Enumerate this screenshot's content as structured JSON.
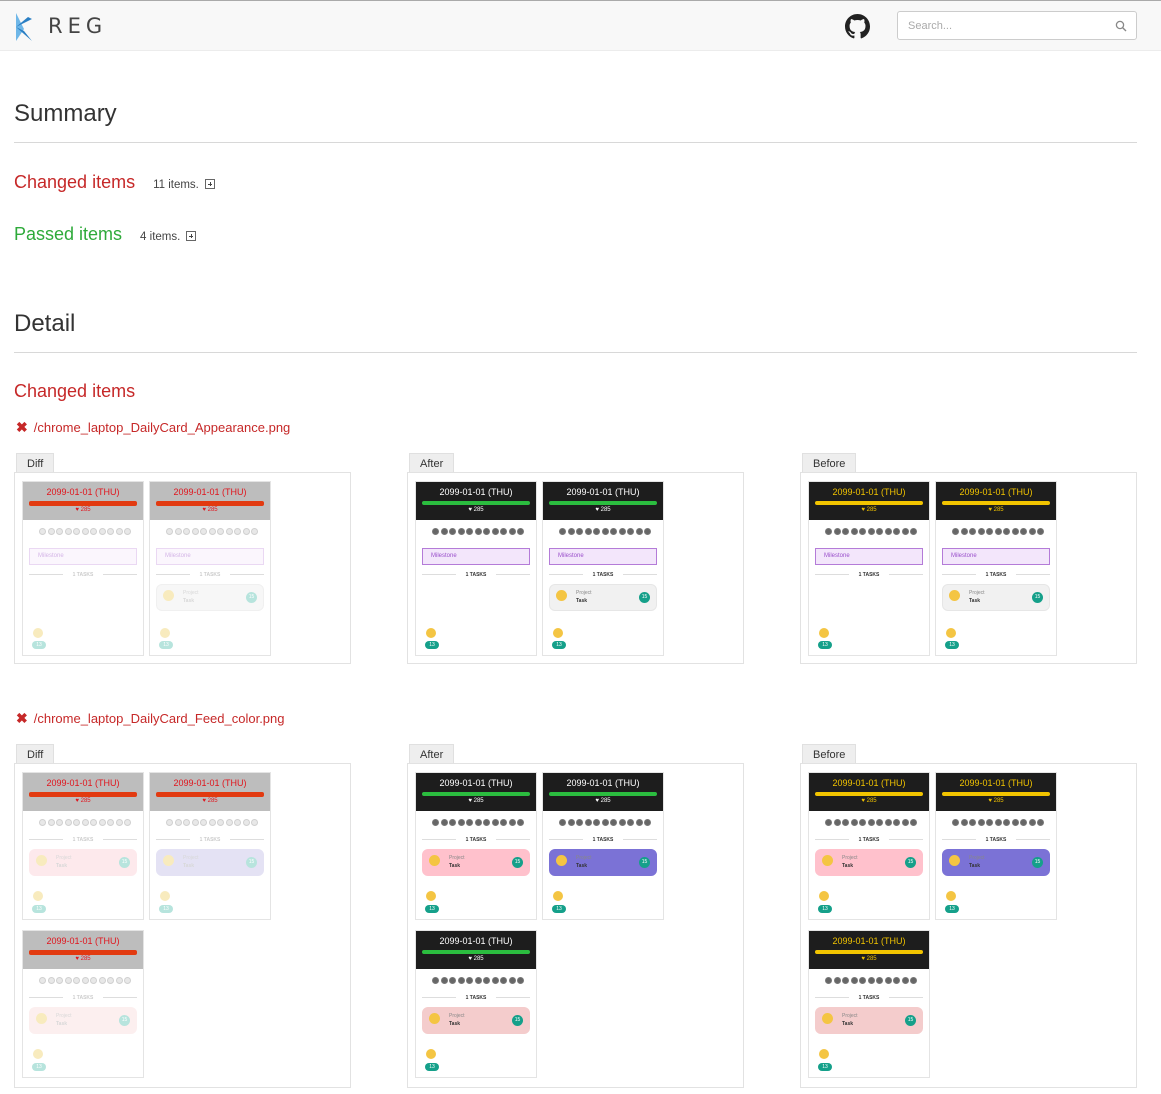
{
  "header": {
    "brand": "REG",
    "search_placeholder": "Search..."
  },
  "summary": {
    "title": "Summary",
    "changed_label": "Changed items",
    "changed_count": "11 items.",
    "passed_label": "Passed items",
    "passed_count": "4 items."
  },
  "detail": {
    "title": "Detail",
    "changed_label": "Changed items",
    "files": [
      {
        "name": "/chrome_laptop_DailyCard_Appearance.png"
      },
      {
        "name": "/chrome_laptop_DailyCard_Feed_color.png"
      }
    ],
    "tabs": {
      "diff": "Diff",
      "after": "After",
      "before": "Before"
    }
  },
  "card": {
    "date": "2099-01-01 (THU)",
    "heart": "♥ 285",
    "milestone": "Milestone",
    "tasks": "1 TASKS",
    "project": "Project",
    "task": "Task",
    "num": "15",
    "foot_num": "13"
  },
  "colors": {
    "changed": "#c62828",
    "passed": "#2eaa3a",
    "progress_after": "#2bbd3f",
    "progress_before": "#f2c400",
    "task_pink": "#ffc1cc",
    "task_purple": "#7b72d6",
    "task_salmon": "#f4cccc"
  },
  "icons": [
    "reg-logo-icon",
    "github-icon",
    "search-icon",
    "expand-icon",
    "close-icon"
  ]
}
